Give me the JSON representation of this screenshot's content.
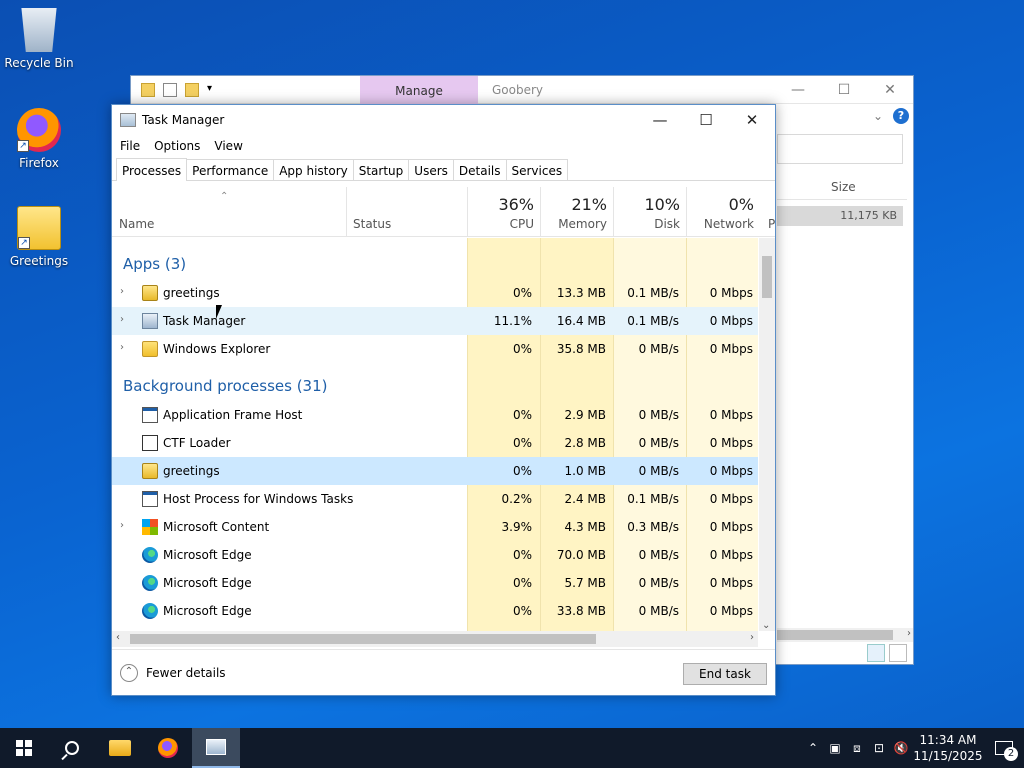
{
  "desktop": {
    "icons": [
      {
        "label": "Recycle Bin",
        "icon": "recycle-bin-icon"
      },
      {
        "label": "Firefox",
        "icon": "firefox-icon"
      },
      {
        "label": "Greetings",
        "icon": "folder-icon"
      }
    ]
  },
  "explorer": {
    "manage_tab": "Manage",
    "title": "Goobery",
    "size_header": "Size",
    "size_value": "11,175 KB",
    "minimize": "—",
    "maximize": "☐",
    "close": "✕",
    "help": "?"
  },
  "taskmanager": {
    "title": "Task Manager",
    "menu": [
      "File",
      "Options",
      "View"
    ],
    "tabs": [
      "Processes",
      "Performance",
      "App history",
      "Startup",
      "Users",
      "Details",
      "Services"
    ],
    "active_tab": "Processes",
    "columns": {
      "name": "Name",
      "status": "Status",
      "cpu": {
        "pct": "36%",
        "label": "CPU"
      },
      "memory": {
        "pct": "21%",
        "label": "Memory"
      },
      "disk": {
        "pct": "10%",
        "label": "Disk"
      },
      "network": {
        "pct": "0%",
        "label": "Network"
      },
      "power_cut": "P"
    },
    "groups": {
      "apps": "Apps (3)",
      "background": "Background processes (31)"
    },
    "apps": [
      {
        "name": "greetings",
        "cpu": "0%",
        "mem": "13.3 MB",
        "disk": "0.1 MB/s",
        "net": "0 Mbps",
        "icon": "greetings-app-icon"
      },
      {
        "name": "Task Manager",
        "cpu": "11.1%",
        "mem": "16.4 MB",
        "disk": "0.1 MB/s",
        "net": "0 Mbps",
        "icon": "task-manager-icon"
      },
      {
        "name": "Windows Explorer",
        "cpu": "0%",
        "mem": "35.8 MB",
        "disk": "0 MB/s",
        "net": "0 Mbps",
        "icon": "folder-icon"
      }
    ],
    "background": [
      {
        "name": "Application Frame Host",
        "cpu": "0%",
        "mem": "2.9 MB",
        "disk": "0 MB/s",
        "net": "0 Mbps",
        "icon": "app-frame-icon"
      },
      {
        "name": "CTF Loader",
        "cpu": "0%",
        "mem": "2.8 MB",
        "disk": "0 MB/s",
        "net": "0 Mbps",
        "icon": "ctf-loader-icon"
      },
      {
        "name": "greetings",
        "cpu": "0%",
        "mem": "1.0 MB",
        "disk": "0 MB/s",
        "net": "0 Mbps",
        "icon": "greetings-app-icon"
      },
      {
        "name": "Host Process for Windows Tasks",
        "cpu": "0.2%",
        "mem": "2.4 MB",
        "disk": "0.1 MB/s",
        "net": "0 Mbps",
        "icon": "app-frame-icon"
      },
      {
        "name": "Microsoft Content",
        "cpu": "3.9%",
        "mem": "4.3 MB",
        "disk": "0.3 MB/s",
        "net": "0 Mbps",
        "icon": "microsoft-icon"
      },
      {
        "name": "Microsoft Edge",
        "cpu": "0%",
        "mem": "70.0 MB",
        "disk": "0 MB/s",
        "net": "0 Mbps",
        "icon": "edge-icon"
      },
      {
        "name": "Microsoft Edge",
        "cpu": "0%",
        "mem": "5.7 MB",
        "disk": "0 MB/s",
        "net": "0 Mbps",
        "icon": "edge-icon"
      },
      {
        "name": "Microsoft Edge",
        "cpu": "0%",
        "mem": "33.8 MB",
        "disk": "0 MB/s",
        "net": "0 Mbps",
        "icon": "edge-icon"
      }
    ],
    "fewer_details": "Fewer details",
    "end_task": "End task"
  },
  "taskbar": {
    "time": "11:34 AM",
    "date": "11/15/2025",
    "notifications": "2"
  }
}
